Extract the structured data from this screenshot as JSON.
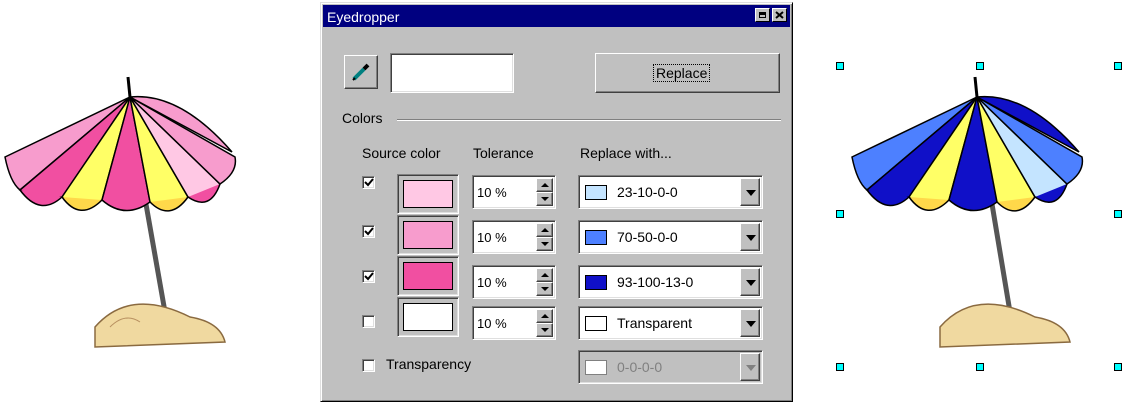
{
  "dialog": {
    "title": "Eyedropper",
    "replace_button": "Replace",
    "colors_group": "Colors",
    "headers": {
      "source": "Source color",
      "tolerance": "Tolerance",
      "replace_with": "Replace with..."
    },
    "rows": [
      {
        "checked": true,
        "source_color": "#ffc8e4",
        "tolerance": "10 %",
        "replace_label": "23-10-0-0",
        "replace_color": "#c4e4ff"
      },
      {
        "checked": true,
        "source_color": "#f79ccd",
        "tolerance": "10 %",
        "replace_label": "70-50-0-0",
        "replace_color": "#4d80ff"
      },
      {
        "checked": true,
        "source_color": "#f14fa1",
        "tolerance": "10 %",
        "replace_label": "93-100-13-0",
        "replace_color": "#1010c8"
      },
      {
        "checked": false,
        "source_color": "#ffffff",
        "tolerance": "10 %",
        "replace_label": "Transparent",
        "replace_color": "#ffffff"
      }
    ],
    "transparency": {
      "label": "Transparency",
      "checked": false,
      "value": "0-0-0-0"
    }
  },
  "artwork": {
    "original_colors": [
      "#ffc8e4",
      "#f79ccd",
      "#f14fa1"
    ],
    "replaced_colors": [
      "#c4e4ff",
      "#4d80ff",
      "#1010c8"
    ],
    "yellow": "#ffff66"
  }
}
